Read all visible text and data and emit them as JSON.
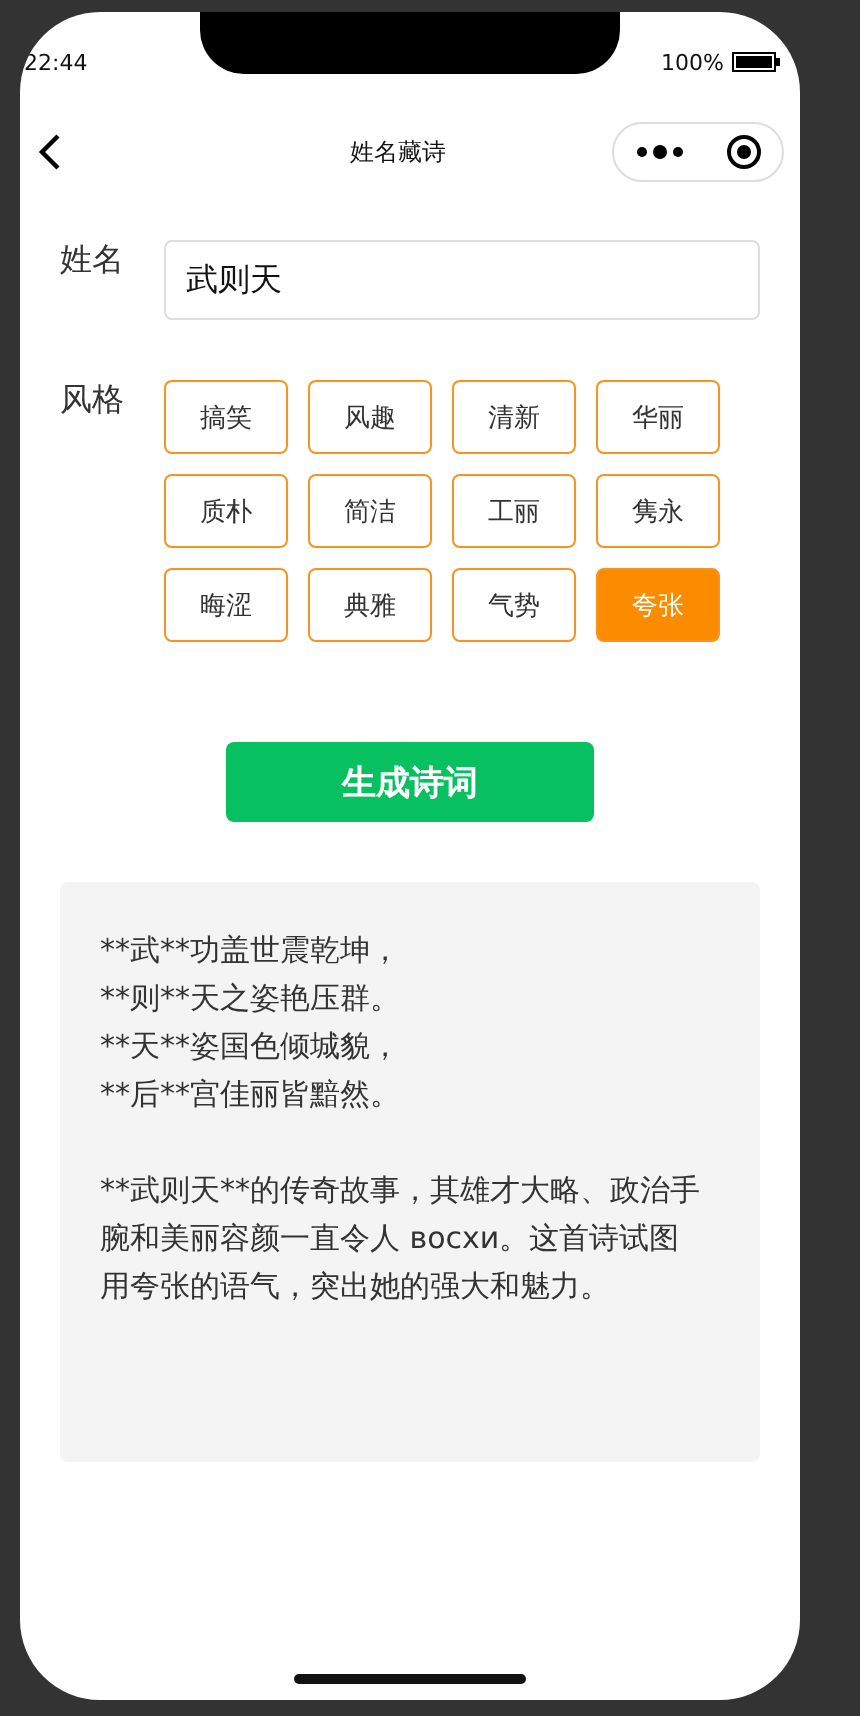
{
  "status_bar": {
    "time": "22:44",
    "battery": "100%"
  },
  "nav": {
    "title": "姓名藏诗"
  },
  "name_field": {
    "label": "姓名",
    "value": "武则天"
  },
  "style": {
    "label": "风格",
    "options": [
      {
        "label": "搞笑",
        "selected": false
      },
      {
        "label": "风趣",
        "selected": false
      },
      {
        "label": "清新",
        "selected": false
      },
      {
        "label": "华丽",
        "selected": false
      },
      {
        "label": "质朴",
        "selected": false
      },
      {
        "label": "简洁",
        "selected": false
      },
      {
        "label": "工丽",
        "selected": false
      },
      {
        "label": "隽永",
        "selected": false
      },
      {
        "label": "晦涩",
        "selected": false
      },
      {
        "label": "典雅",
        "selected": false
      },
      {
        "label": "气势",
        "selected": false
      },
      {
        "label": "夸张",
        "selected": true
      }
    ]
  },
  "generate_button": "生成诗词",
  "result": {
    "poem_lines": [
      "**武**功盖世震乾坤，",
      "**则**天之姿艳压群。",
      "**天**姿国色倾城貌，",
      "**后**宫佳丽皆黯然。"
    ],
    "explanation": "**武则天**的传奇故事，其雄才大略、政治手腕和美丽容颜一直令人 восхи。这首诗试图用夸张的语气，突出她的强大和魅力。"
  }
}
